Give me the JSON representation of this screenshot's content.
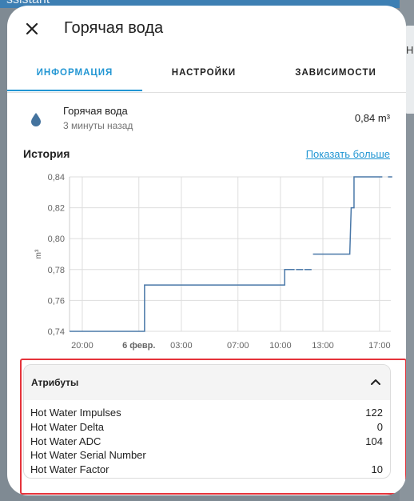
{
  "background": {
    "title_fragment": "ssistant",
    "side_letter": "H"
  },
  "dialog": {
    "title": "Горячая вода"
  },
  "tabs": [
    {
      "label": "ИНФОРМАЦИЯ",
      "active": true
    },
    {
      "label": "НАСТРОЙКИ",
      "active": false
    },
    {
      "label": "ЗАВИСИМОСТИ",
      "active": false
    }
  ],
  "entity": {
    "icon": "water-drop-icon",
    "name": "Горячая вода",
    "last_changed": "3 минуты назад",
    "state": "0,84 m³"
  },
  "history": {
    "title": "История",
    "show_more": "Показать больше"
  },
  "chart_data": {
    "type": "line",
    "step": true,
    "ylabel": "m³",
    "ylim": [
      0.74,
      0.84
    ],
    "y_ticks": [
      "0,84",
      "0,82",
      "0,80",
      "0,78",
      "0,76",
      "0,74"
    ],
    "x_ticks": [
      "20:00",
      "6 февр.",
      "03:00",
      "07:00",
      "10:00",
      "13:00",
      "17:00"
    ],
    "x_hours_range": [
      -4.9,
      17.8
    ],
    "grid": true,
    "series": [
      {
        "color": "#4a78a8",
        "points": [
          [
            -4.9,
            0.74
          ],
          [
            0.4,
            0.74
          ],
          [
            0.4,
            0.77
          ],
          [
            10.3,
            0.77
          ],
          [
            10.3,
            0.78
          ],
          [
            11.0,
            0.78
          ]
        ],
        "dashes": [
          [
            11.1,
            11.6,
            0.78
          ],
          [
            11.7,
            12.2,
            0.78
          ]
        ],
        "segments2": [
          [
            [
              12.3,
              0.79
            ],
            [
              14.9,
              0.79
            ],
            [
              15.0,
              0.82
            ],
            [
              15.2,
              0.82
            ],
            [
              15.2,
              0.84
            ],
            [
              17.2,
              0.84
            ]
          ]
        ],
        "tail": [
          [
            17.6,
            17.9,
            0.84
          ]
        ]
      }
    ],
    "colors": {
      "line": "#4a78a8",
      "grid": "#dddddd",
      "axis": "#cccccc"
    }
  },
  "attributes": {
    "title": "Атрибуты",
    "items": [
      {
        "key": "Hot Water Impulses",
        "value": "122"
      },
      {
        "key": "Hot Water Delta",
        "value": "0"
      },
      {
        "key": "Hot Water ADC",
        "value": "104"
      },
      {
        "key": "Hot Water Serial Number",
        "value": ""
      },
      {
        "key": "Hot Water Factor",
        "value": "10"
      }
    ]
  },
  "colors": {
    "accent": "#2296d3",
    "highlight": "#e5333b"
  }
}
